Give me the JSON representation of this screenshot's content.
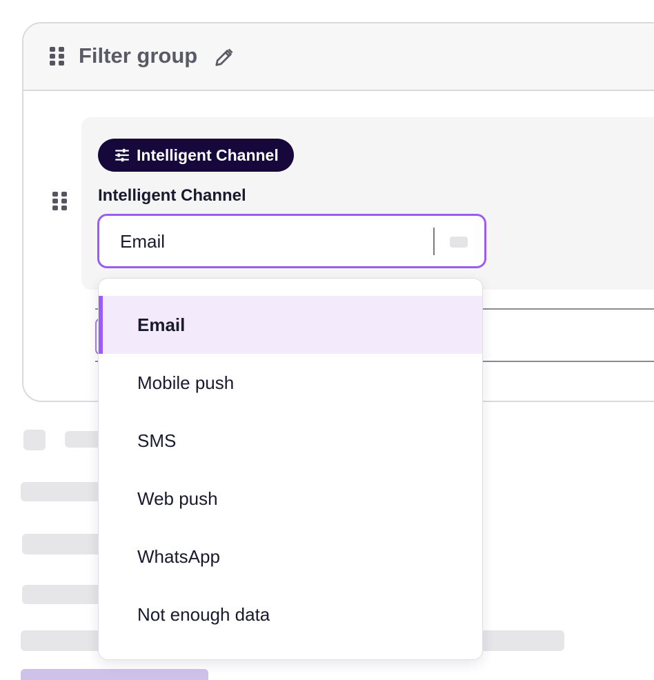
{
  "filter_group": {
    "title": "Filter group",
    "edit_icon": "pencil-icon",
    "drag_icon": "drag-handle-icon"
  },
  "condition": {
    "chip_label": "Intelligent Channel",
    "chip_icon": "sliders-icon",
    "field_label": "Intelligent Channel",
    "selected_value": "Email"
  },
  "dropdown": {
    "options": [
      {
        "label": "Email",
        "selected": true
      },
      {
        "label": "Mobile push",
        "selected": false
      },
      {
        "label": "SMS",
        "selected": false
      },
      {
        "label": "Web push",
        "selected": false
      },
      {
        "label": "WhatsApp",
        "selected": false
      },
      {
        "label": "Not enough data",
        "selected": false
      }
    ]
  },
  "colors": {
    "accent": "#9b5cf5",
    "chip_bg": "#16083a",
    "selected_option_bg": "#f3ebfb"
  }
}
